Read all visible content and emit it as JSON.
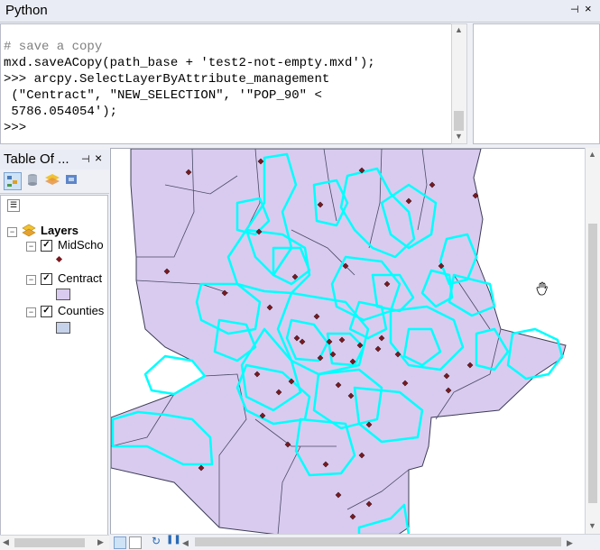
{
  "python_window": {
    "title": "Python",
    "pin_glyph": "⊣",
    "close_glyph": "×",
    "code_lines": [
      "# save a copy",
      "mxd.saveACopy(path_base + 'test2-not-empty.mxd');",
      ">>> arcpy.SelectLayerByAttribute_management",
      " (\"Centract\", \"NEW_SELECTION\", '\"POP_90\" <",
      " 5786.054054');",
      ">>>"
    ]
  },
  "toc": {
    "title": "Table Of ...",
    "pin_glyph": "⊣",
    "close_glyph": "×",
    "tools": [
      "list-by-drawing-order",
      "list-by-source",
      "list-by-visibility",
      "list-by-selection"
    ],
    "options_glyph": "☰",
    "root": {
      "label": "Layers",
      "expander": "⊟"
    },
    "layers": [
      {
        "label": "MidScho",
        "checked": "✓",
        "symbol": "point",
        "symbol_color": "#7a1820"
      },
      {
        "label": "Centract",
        "checked": "✓",
        "symbol": "fill",
        "symbol_color": "#d9cbef"
      },
      {
        "label": "Counties",
        "checked": "✓",
        "symbol": "fill",
        "symbol_color": "#c5d2ea"
      }
    ]
  },
  "map": {
    "county_fill": "#d9cbef",
    "county_stroke": "#3d3d55",
    "selected_outline": "#00ffff",
    "school_color": "#7a1820",
    "cursor": "pan-hand"
  },
  "bottom_bar": {
    "buttons": [
      "layout-view",
      "data-view",
      "refresh",
      "pause-drawing"
    ]
  },
  "colors": {
    "panel_bg": "#eef0f5",
    "title_bg": "#e9ecf4"
  }
}
